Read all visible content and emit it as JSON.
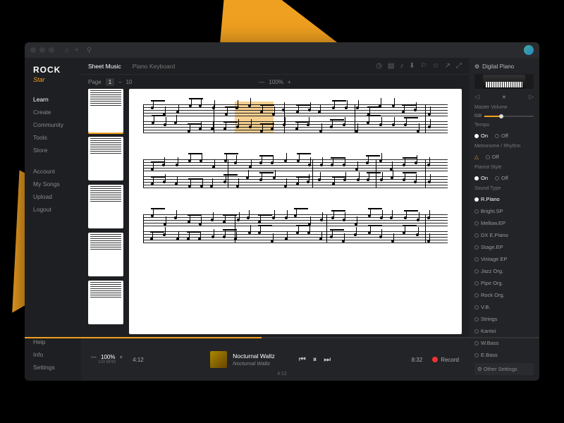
{
  "brand": {
    "name": "ROCK",
    "sub": "Star"
  },
  "nav": {
    "primary": [
      "Learn",
      "Create",
      "Community",
      "Tools",
      "Store"
    ],
    "secondary": [
      "Account",
      "My Songs",
      "Upload",
      "Logout"
    ],
    "footer": [
      "Help",
      "Info",
      "Settings"
    ]
  },
  "tabs": {
    "items": [
      "Sheet Music",
      "Piano Keyboard"
    ],
    "active": 0
  },
  "page": {
    "label": "Page",
    "current": "1",
    "total": "10"
  },
  "zoom": {
    "label": "100%",
    "minus": "—",
    "plus": "+"
  },
  "player": {
    "zoom_pct": "100%",
    "zoom_sub": "120 BPM",
    "time_cur": "4:12",
    "time_total": "8:32",
    "track_title": "Nocturnal Waltz",
    "track_artist": "Nocturnal Waltz",
    "pos_label": "4:12",
    "record": "Record"
  },
  "panel": {
    "title": "Digital Piano",
    "master": "Master Volume",
    "vol": "028",
    "tempo": "Tempo",
    "on": "On",
    "off": "Off",
    "metro": "Metronome / Rhythm",
    "pianist": "Pianist Style",
    "soundtype": "Sound Type",
    "sounds": [
      "R.Piano",
      "Bright.SP",
      "Mellow.EP",
      "DX E.Piano",
      "Stage.EP",
      "Vintage EP",
      "Jazz Org.",
      "Pipe Org.",
      "Rock Org.",
      "V.B.",
      "Strings",
      "Kantoi",
      "W.Bass",
      "E.Bass"
    ],
    "other": "Other Settings"
  }
}
